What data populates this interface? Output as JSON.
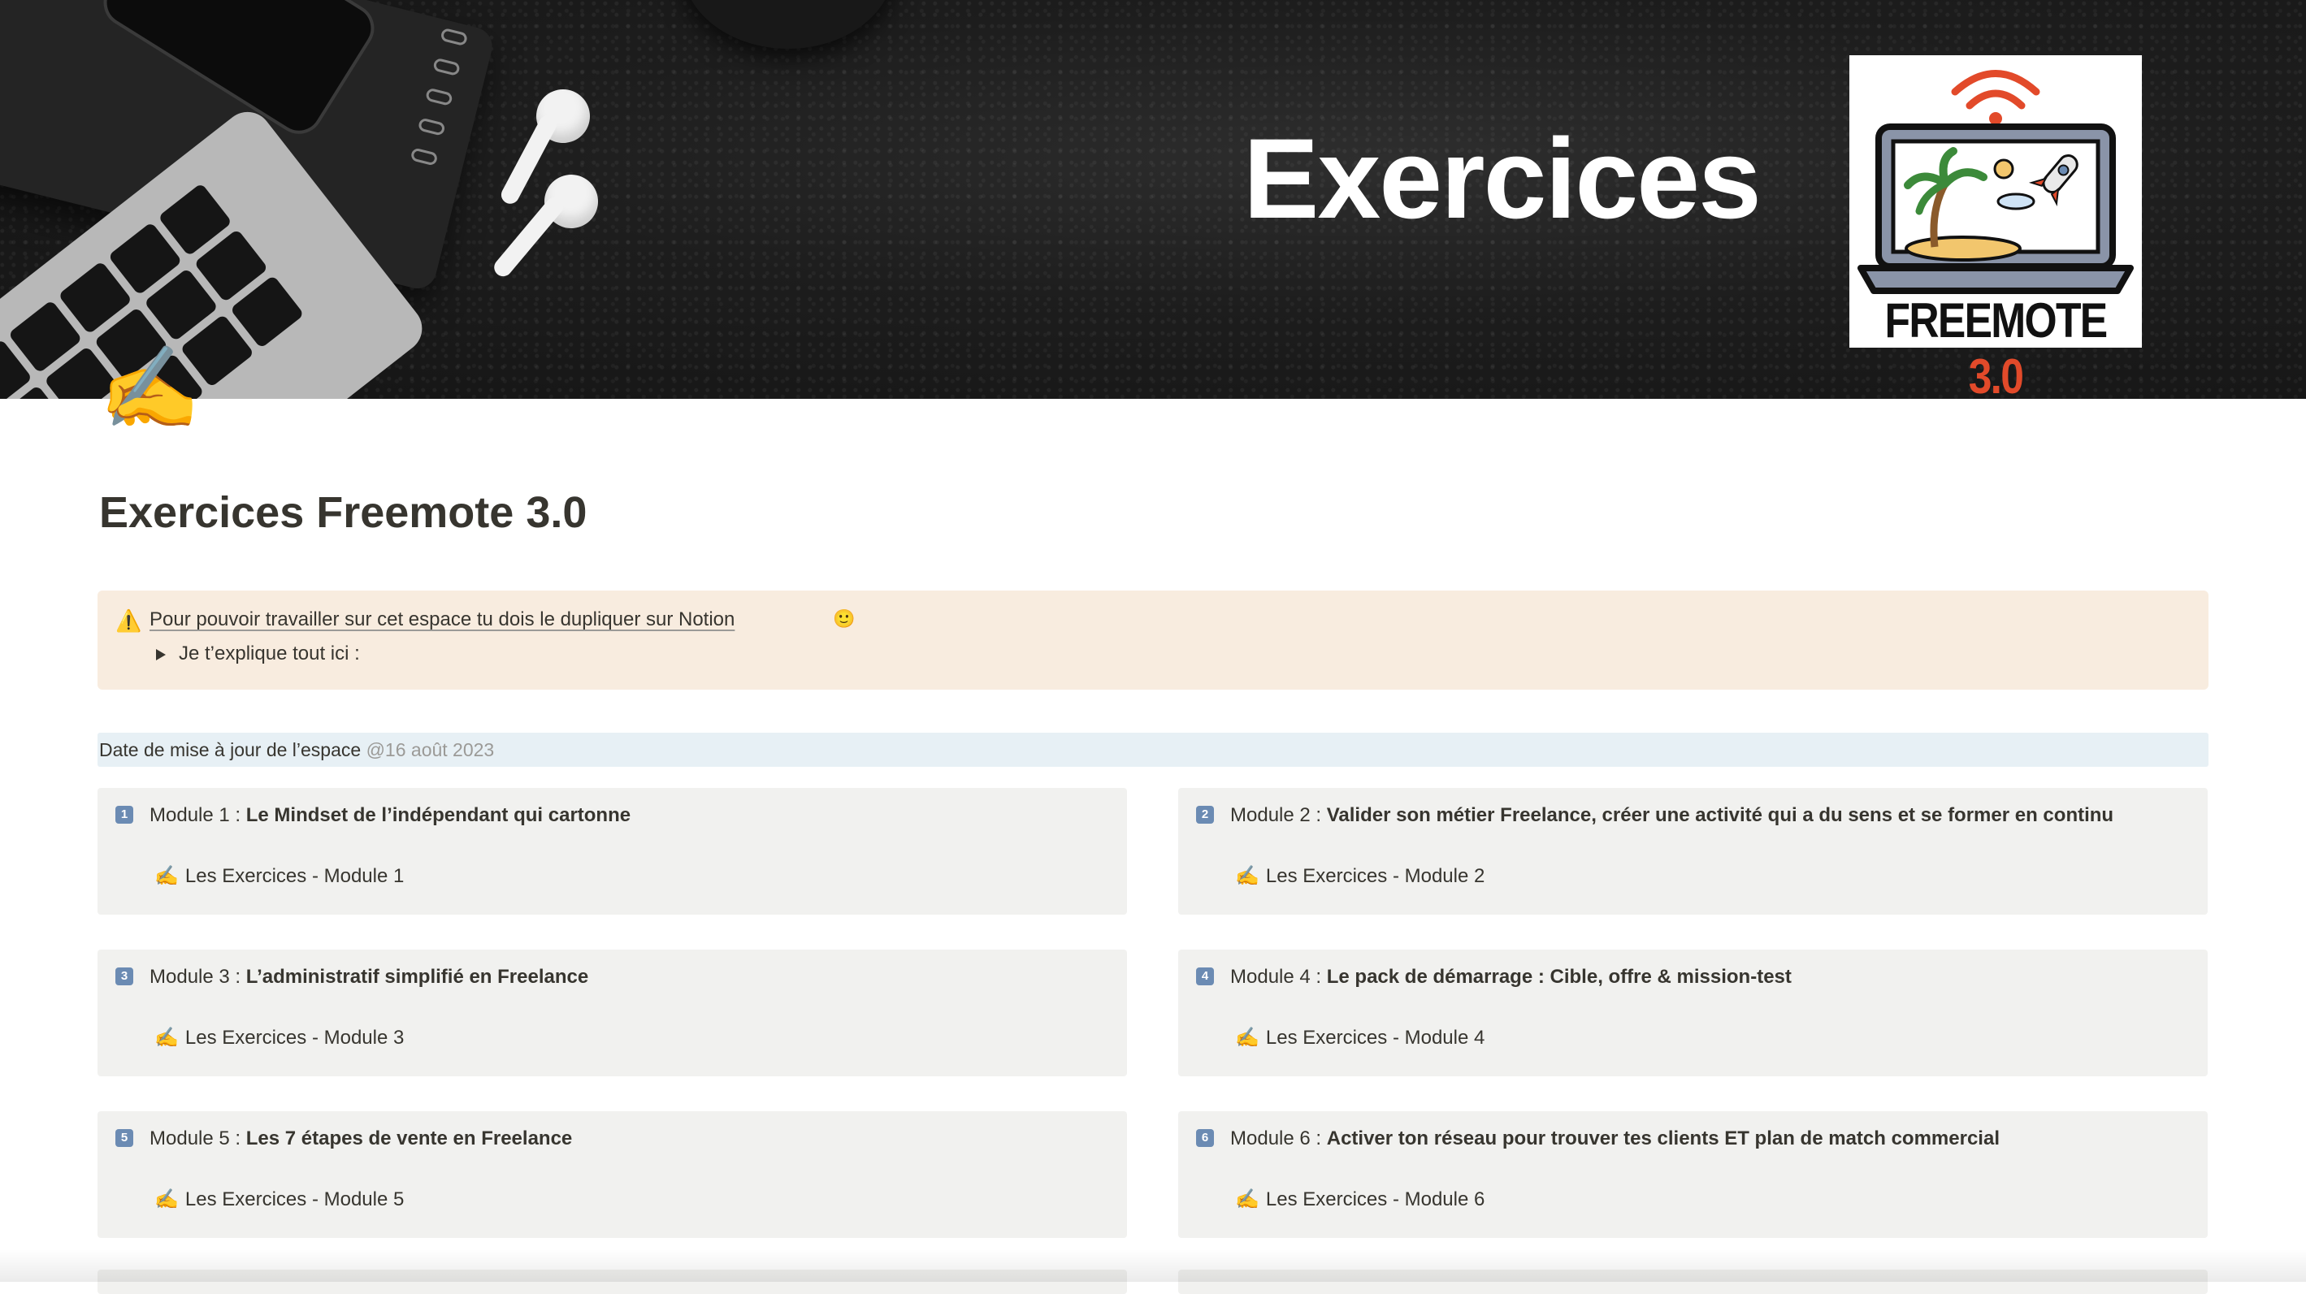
{
  "cover": {
    "title": "Exercices",
    "logo_text_main": "FREEMOTE",
    "logo_text_version": "3.0",
    "logo_accent_color": "#e24a2a"
  },
  "page": {
    "icon": "✍️",
    "icon_name": "writing-hand-icon",
    "title": "Exercices Freemote 3.0"
  },
  "callout": {
    "icon": "⚠️",
    "link_text": "Pour pouvoir travailler sur cet espace tu dois le dupliquer sur Notion",
    "emoji": "🙂",
    "toggle_text": "Je t’explique tout ici :",
    "background": "#f8ecdf"
  },
  "update": {
    "label": "Date de mise à jour de l’espace ",
    "date": "@16 août 2023",
    "background": "#e7f0f5"
  },
  "modules": [
    {
      "badge": "1",
      "prefix": "Module 1 : ",
      "name": "Le Mindset de l’indépendant qui cartonne",
      "link_icon": "✍️",
      "link": "Les Exercices - Module 1"
    },
    {
      "badge": "2",
      "prefix": "Module 2 : ",
      "name": "Valider son métier Freelance, créer une activité qui a du sens et se former en continu",
      "link_icon": "✍️",
      "link": "Les Exercices - Module 2"
    },
    {
      "badge": "3",
      "prefix": "Module 3 : ",
      "name": "L’administratif simplifié en Freelance",
      "link_icon": "✍️",
      "link": "Les Exercices - Module 3"
    },
    {
      "badge": "4",
      "prefix": "Module 4 : ",
      "name": "Le pack de démarrage : Cible, offre & mission-test",
      "link_icon": "✍️",
      "link": "Les Exercices - Module 4"
    },
    {
      "badge": "5",
      "prefix": "Module 5 : ",
      "name": "Les 7 étapes de vente en Freelance",
      "link_icon": "✍️",
      "link": "Les Exercices - Module 5"
    },
    {
      "badge": "6",
      "prefix": "Module 6 : ",
      "name": "Activer ton réseau pour trouver tes clients ET plan de match commercial",
      "link_icon": "✍️",
      "link": "Les Exercices - Module 6"
    }
  ]
}
